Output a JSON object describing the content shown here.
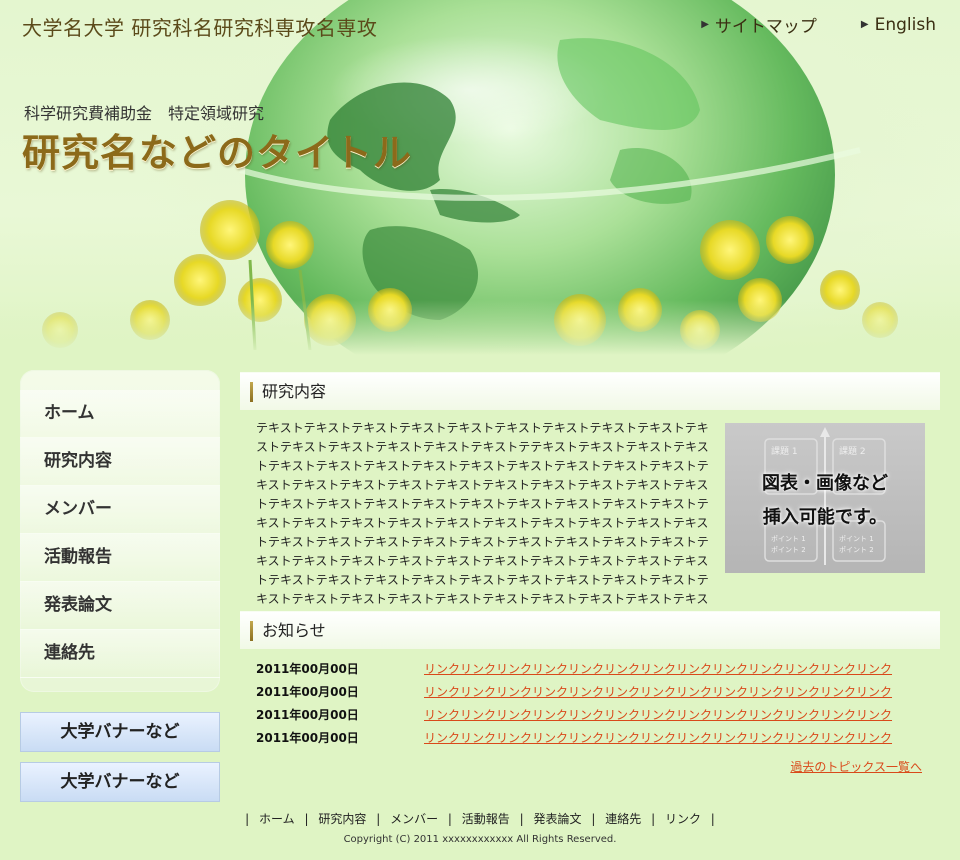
{
  "header": {
    "university": "大学名大学 研究科名研究科専攻名専攻",
    "top_links": [
      {
        "label": "サイトマップ"
      },
      {
        "label": "English"
      }
    ],
    "grant": "科学研究費補助金　特定領域研究",
    "title": "研究名などのタイトル"
  },
  "sidebar": {
    "items": [
      {
        "label": "ホーム"
      },
      {
        "label": "研究内容"
      },
      {
        "label": "メンバー"
      },
      {
        "label": "活動報告"
      },
      {
        "label": "発表論文"
      },
      {
        "label": "連絡先"
      }
    ],
    "banners": [
      "大学バナーなど",
      "大学バナーなど"
    ]
  },
  "research": {
    "heading": "研究内容",
    "text": "テキストテキストテキストテキストテキストテキストテキストテキストテキストテキストテキストテキストテキストテキストテキストテテキストテキストテキストテキストテキストテキストテキストテキストテキストテキストテキストテキストテキストテキストテキストテキストテキストテキストテキストテキストテキストテキストテキストテキストテキストテキストテキストテキストテキストテキストテキストテキストテキストテキストテキストテキストテキストテキストテキストテキストテキストテキストテキストテキストテキストテキストテキストテキストテキストテキストテキストテキストテキストテキストテキストテキストテキストテキストテキストテキストテキストテキストテキストテキストテキストテキストテキストテキストテキストテキストテキストテキストテキストテキストテキストテキストテキストテキストテキストテキストテキストテキストテキストテキストテキストテキストテキストテキストテキストテキスト",
    "figure_lines": [
      "図表・画像など",
      "挿入可能です。"
    ],
    "figure_labels": {
      "task1": "課題 1",
      "task2": "課題 2",
      "point1": "ポイント 1",
      "point2": "ポイント 2"
    }
  },
  "news": {
    "heading": "お知らせ",
    "items": [
      {
        "date": "2011年00月00日",
        "link": "リンクリンクリンクリンクリンクリンクリンクリンクリンクリンクリンクリンクリンク"
      },
      {
        "date": "2011年00月00日",
        "link": "リンクリンクリンクリンクリンクリンクリンクリンクリンクリンクリンクリンクリンク"
      },
      {
        "date": "2011年00月00日",
        "link": "リンクリンクリンクリンクリンクリンクリンクリンクリンクリンクリンクリンクリンク"
      },
      {
        "date": "2011年00月00日",
        "link": "リンクリンクリンクリンクリンクリンクリンクリンクリンクリンクリンクリンクリンク"
      }
    ],
    "past_topics": "過去のトピックス一覧へ"
  },
  "footer": {
    "items": [
      "ホーム",
      "研究内容",
      "メンバー",
      "活動報告",
      "発表論文",
      "連絡先",
      "リンク"
    ],
    "separator": "|",
    "copyright": "Copyright (C) 2011 xxxxxxxxxxxx All Rights Reserved."
  },
  "colors": {
    "background": "#dff4c4",
    "title_gold": "#8c6a1a",
    "link_orange": "#d9491a",
    "banner_blue": "#c9dcf4"
  }
}
